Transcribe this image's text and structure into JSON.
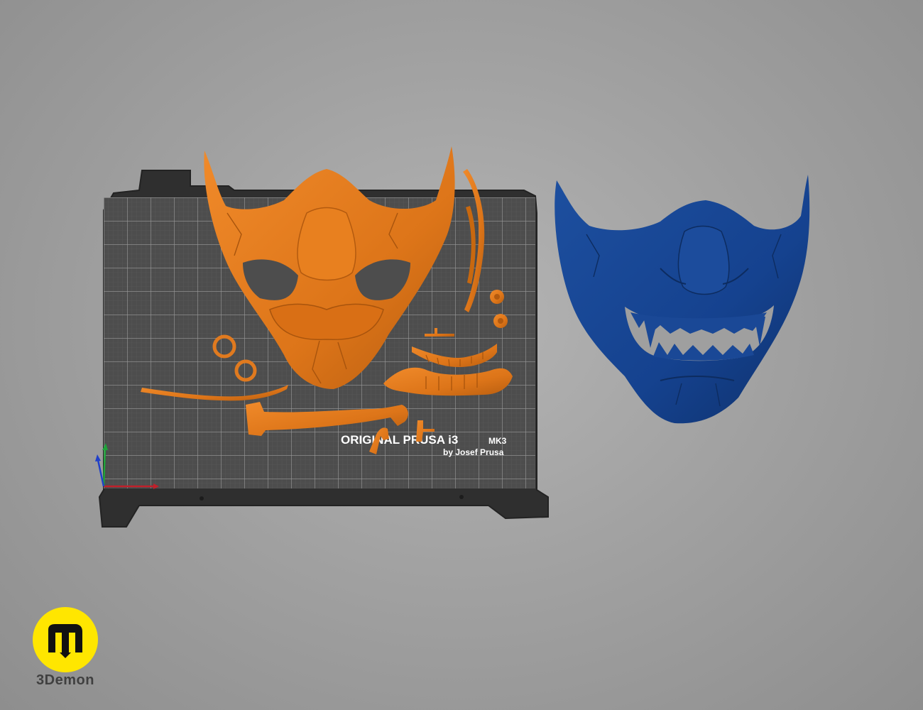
{
  "bed": {
    "label_title": "ORIGINAL PRUSA i3",
    "label_model": "MK3",
    "label_by": "by Josef Prusa"
  },
  "objects": {
    "printed_parts": {
      "name": "orange-mask-parts",
      "color": "#e07a1f"
    },
    "preview_mask": {
      "name": "blue-assembled-mask",
      "color": "#15428f"
    }
  },
  "axes": {
    "x_color": "#c0202a",
    "y_color": "#1fa23a",
    "z_color": "#2040c8"
  },
  "brand": {
    "name": "3Demon",
    "logo_color": "#ffe600"
  }
}
